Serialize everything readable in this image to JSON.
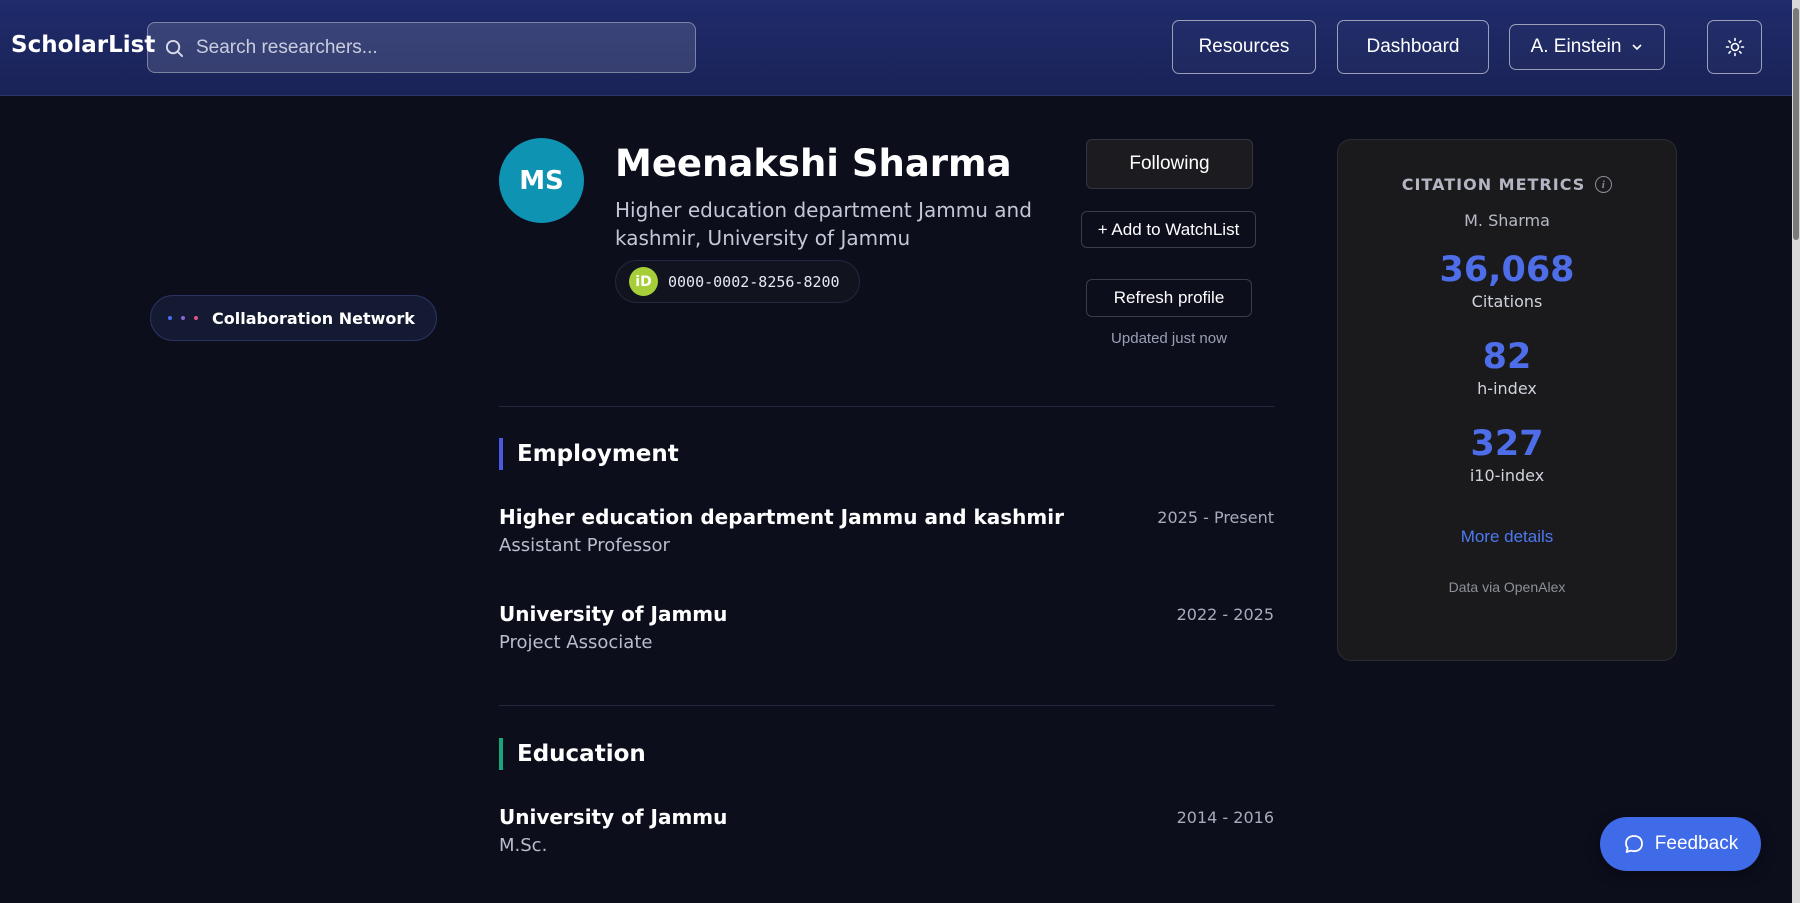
{
  "header": {
    "brand": "ScholarList",
    "search_placeholder": "Search researchers...",
    "resources_label": "Resources",
    "dashboard_label": "Dashboard",
    "user_label": "A. Einstein",
    "theme_icon": "sun-icon"
  },
  "sidebar": {
    "collab_label": "Collaboration Network",
    "collab_dot_colors": [
      "#4a6cf7",
      "#8a63d2",
      "#e0508a"
    ]
  },
  "profile": {
    "initials": "MS",
    "name": "Meenakshi Sharma",
    "affiliation": "Higher education department Jammu and kashmir, University of Jammu",
    "orcid_badge": "iD",
    "orcid": "0000-0002-8256-8200",
    "avatar_color": "#0f93b3"
  },
  "actions": {
    "following_label": "Following",
    "watchlist_label": "+ Add to WatchList",
    "refresh_label": "Refresh profile",
    "updated_text": "Updated just now"
  },
  "employment": {
    "title": "Employment",
    "accent": "#4a5ae0",
    "entries": [
      {
        "org": "Higher education department Jammu and kashmir",
        "role": "Assistant Professor",
        "years": "2025 - Present"
      },
      {
        "org": "University of Jammu",
        "role": "Project Associate",
        "years": "2022 - 2025"
      }
    ]
  },
  "education": {
    "title": "Education",
    "accent": "#17a67a",
    "entries": [
      {
        "org": "University of Jammu",
        "role": "M.Sc.",
        "years": "2014 - 2016"
      }
    ]
  },
  "metrics": {
    "title": "CITATION METRICS",
    "info_icon": "info-icon",
    "short_name": "M. Sharma",
    "citations_value": "36,068",
    "citations_label": "Citations",
    "h_index_value": "82",
    "h_index_label": "h-index",
    "i10_value": "327",
    "i10_label": "i10-index",
    "more_label": "More details",
    "source": "Data via OpenAlex"
  },
  "feedback": {
    "label": "Feedback",
    "icon": "chat-bubble-icon"
  }
}
